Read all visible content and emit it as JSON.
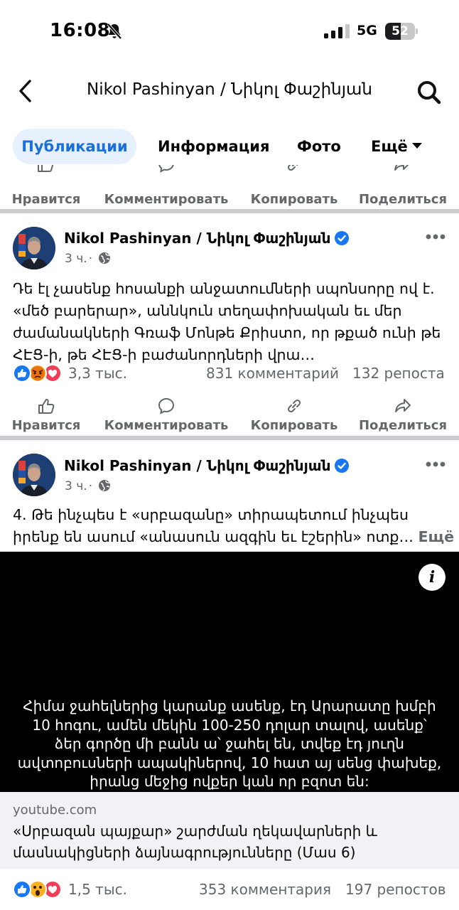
{
  "status_bar": {
    "time": "16:08",
    "network": "5G",
    "battery": "52",
    "battery_level": 0.52
  },
  "header": {
    "title": "Nikol Pashinyan / Նիկոլ Փաշինյան"
  },
  "tabs": [
    {
      "label": "Публикации",
      "active": true
    },
    {
      "label": "Информация"
    },
    {
      "label": "Фото"
    },
    {
      "label": "Ещё"
    }
  ],
  "actions": {
    "like": "Нравится",
    "comment": "Комментировать",
    "copy": "Копировать",
    "share": "Поделиться"
  },
  "posts": [
    {
      "author": "Nikol Pashinyan / Նիկոլ Փաշինյան",
      "time": "3 ч.",
      "text_lines": [
        "Դե էլ չասենք հոսանքի անջատումների սպոնսորը ով է.",
        "«մեծ բարերար», աննկուն տեղափոխական եւ մեր",
        "ժամանակների Գռաֆ Մոնթե Քրիստո, որ թքած ունի թե",
        "ՀԷՑ-ի, թե ՀԷՑ-ի բաժանորդների վրա…"
      ],
      "reactions_count": "3,3 тыс.",
      "comments": "831 комментарий",
      "shares": "132 репоста"
    },
    {
      "author": "Nikol Pashinyan / Նիկոլ Փաշինյան",
      "time": "3 ч.",
      "text_lines": [
        "4. Թե ինչպես է «սրբազանը» տիրապետում ինչպես",
        "իրենք են ասում «անասուն ազգին եւ էշերին» ոտք…"
      ],
      "more": "Ещё",
      "video_subtitle_lines": [
        "Հիմա ջահելներից կարանք ասենք, էդ Արարատը խմբի",
        "10 հոգու, ամեն մեկին 100-250 դոլար տալով, ասենք՝",
        "ձեր գործը մի բանն ա՝ ջահել են, տվեք էդ յուղն",
        "ավտոբուսների ապակիներով, 10 հատ այ սենց փախեք,",
        "իրանց մեջից ովքեր կան որ բզոտ են:"
      ],
      "link_domain": "youtube.com",
      "link_title_lines": [
        "«Սրբազան պայքար» շարժման ղեկավարների և",
        "մասնակիցների ձայնագրությունները (Մաս 6)"
      ],
      "reactions_count": "1,5 тыс.",
      "comments": "353 комментария",
      "shares": "197 репостов"
    }
  ],
  "colors": {
    "accent": "#1b6fd8",
    "tab_active_bg": "#e7f0fd",
    "secondary_text": "#65676b",
    "separator": "#c9ccd1"
  }
}
